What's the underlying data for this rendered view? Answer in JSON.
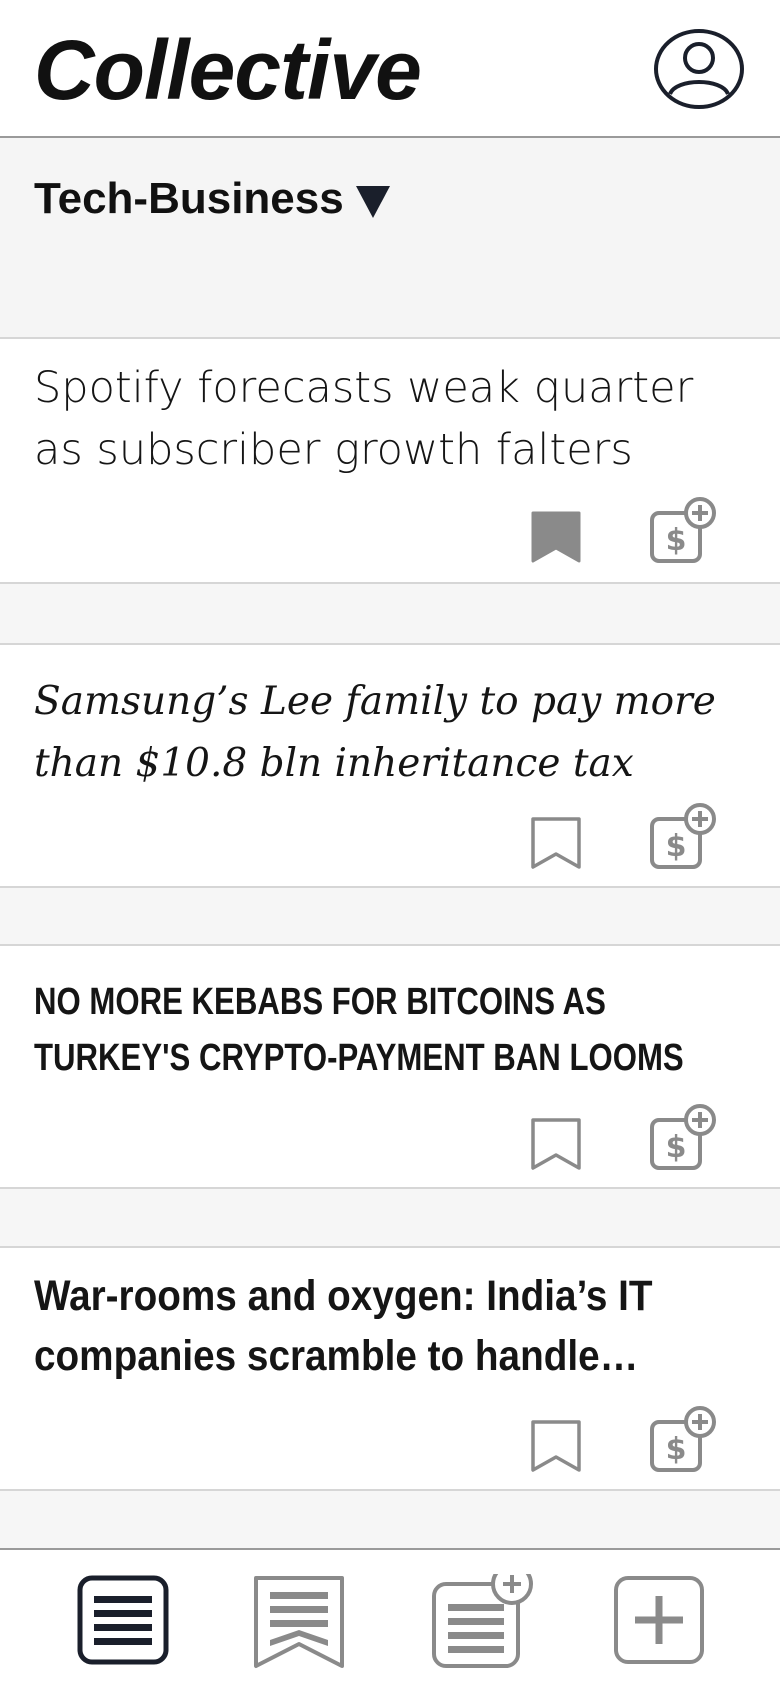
{
  "app": {
    "title": "Collective"
  },
  "icons": {
    "profile": "user-circle-icon",
    "bookmark": "bookmark-icon",
    "tip": "dollar-plus-icon"
  },
  "section": {
    "label": "Tech-Business",
    "caret": "caret-down-icon"
  },
  "articles": [
    {
      "title": "Spotify forecasts weak quarter as subscriber growth falters",
      "bookmarked": true
    },
    {
      "title": "Samsung’s Lee family to pay more than $10.8 bln inheritance tax",
      "bookmarked": false
    },
    {
      "title": "NO MORE KEBABS FOR BITCOINS AS TURKEY'S CRYPTO-PAYMENT BAN LOOMS",
      "bookmarked": false
    },
    {
      "title": "War-rooms and oxygen: India’s IT companies scramble to handle…",
      "bookmarked": false
    }
  ],
  "tabs": [
    {
      "name": "feed",
      "icon": "list-icon",
      "active": true
    },
    {
      "name": "bookmarks",
      "icon": "bookmark-list-icon",
      "active": false
    },
    {
      "name": "add-feed",
      "icon": "list-plus-icon",
      "active": false
    },
    {
      "name": "add",
      "icon": "plus-icon",
      "active": false
    }
  ],
  "colors": {
    "dark": "#1a1f2b",
    "gray": "#8a8a8a",
    "divider": "#d6d6d6",
    "bg": "#f6f6f6"
  }
}
